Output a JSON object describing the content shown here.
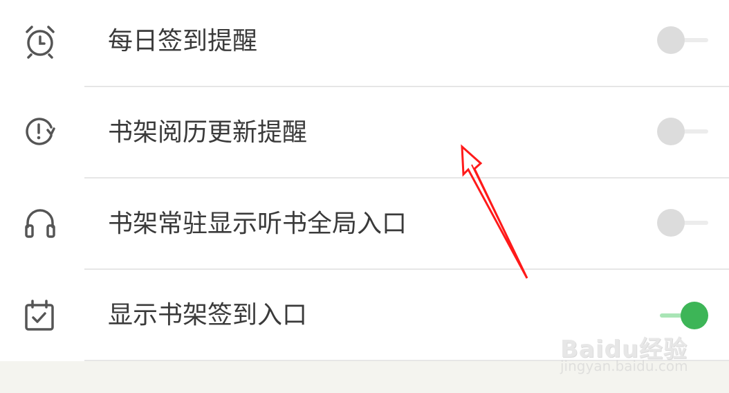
{
  "settings": {
    "items": [
      {
        "label": "每日签到提醒",
        "icon": "alarm-clock-icon",
        "toggle_on": false
      },
      {
        "label": "书架阅历更新提醒",
        "icon": "refresh-alert-icon",
        "toggle_on": false
      },
      {
        "label": "书架常驻显示听书全局入口",
        "icon": "headphones-icon",
        "toggle_on": false
      },
      {
        "label": "显示书架签到入口",
        "icon": "calendar-check-icon",
        "toggle_on": true
      }
    ]
  },
  "colors": {
    "toggle_on": "#3db557",
    "toggle_off": "#dcdcdc",
    "annotation_arrow": "#ff1a1a"
  },
  "watermark": {
    "logo": "Baidu经验",
    "url": "jingyan.baidu.com"
  }
}
